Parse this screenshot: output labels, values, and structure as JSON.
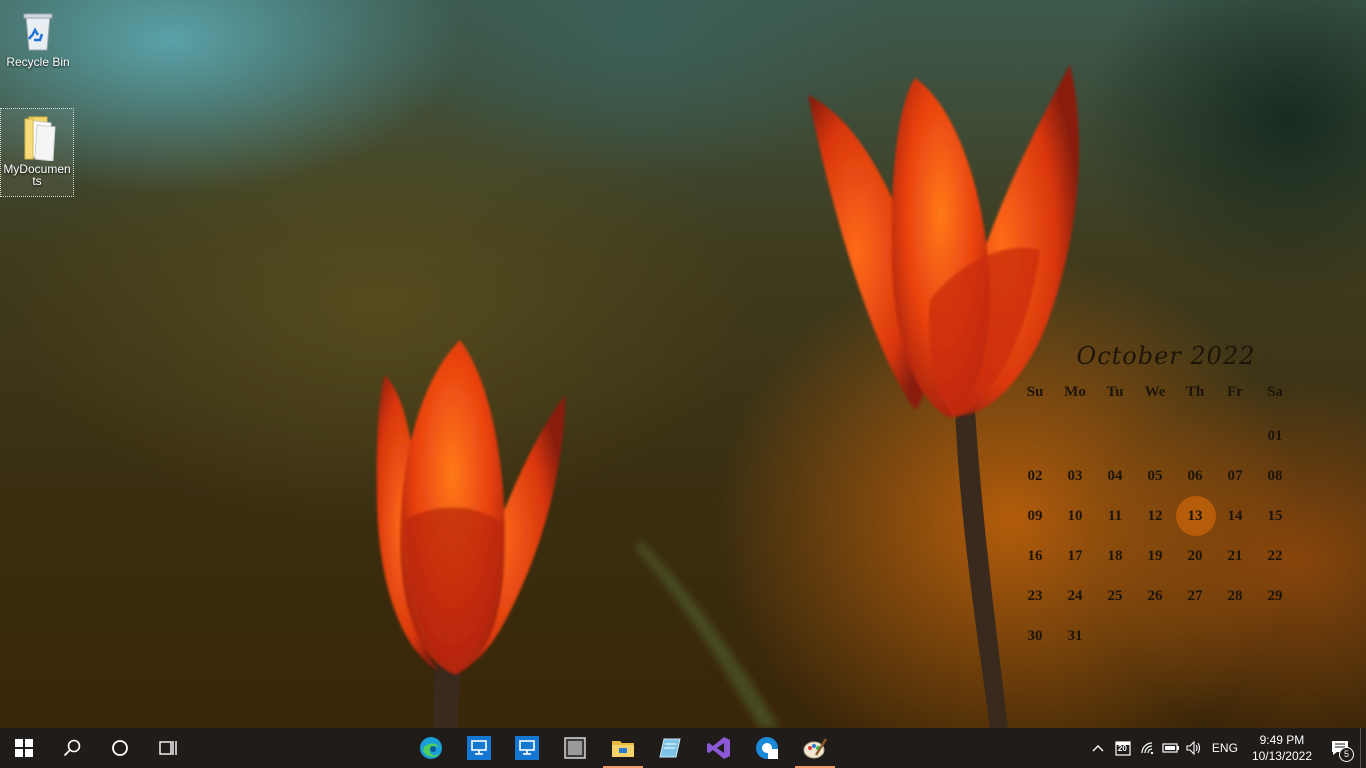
{
  "desktop": {
    "icons": [
      {
        "label": "Recycle Bin",
        "icon": "recycle-bin-icon"
      },
      {
        "label": "MyDocuments",
        "icon": "folder-icon"
      }
    ]
  },
  "calendar": {
    "title": "October 2022",
    "weekdays": [
      "Su",
      "Mo",
      "Tu",
      "We",
      "Th",
      "Fr",
      "Sa"
    ],
    "weeks": [
      [
        "",
        "",
        "",
        "",
        "",
        "",
        "01"
      ],
      [
        "02",
        "03",
        "04",
        "05",
        "06",
        "07",
        "08"
      ],
      [
        "09",
        "10",
        "11",
        "12",
        "13",
        "14",
        "15"
      ],
      [
        "16",
        "17",
        "18",
        "19",
        "20",
        "21",
        "22"
      ],
      [
        "23",
        "24",
        "25",
        "26",
        "27",
        "28",
        "29"
      ],
      [
        "30",
        "31",
        "",
        "",
        "",
        "",
        ""
      ]
    ],
    "today": "13",
    "today_color": "#b95f0a"
  },
  "taskbar": {
    "left_buttons": [
      "windows-start-icon",
      "search-icon",
      "cortana-icon",
      "task-view-icon"
    ],
    "apps": [
      {
        "icon": "edge-icon",
        "active": false
      },
      {
        "icon": "remote-desktop-icon",
        "active": false
      },
      {
        "icon": "remote-desktop-icon",
        "active": false
      },
      {
        "icon": "app-window-icon",
        "active": false
      },
      {
        "icon": "file-explorer-icon",
        "active": true
      },
      {
        "icon": "notepad-icon",
        "active": false
      },
      {
        "icon": "visual-studio-icon",
        "active": false
      },
      {
        "icon": "edge-dev-icon",
        "active": false
      },
      {
        "icon": "paint-icon",
        "active": true
      }
    ],
    "tray": {
      "calendar_badge": "20",
      "language": "ENG",
      "time": "9:49 PM",
      "date": "10/13/2022",
      "notification_count": "5"
    }
  },
  "colors": {
    "taskbar_bg": "#1f1c1a",
    "active_indicator": "#f0a070"
  }
}
